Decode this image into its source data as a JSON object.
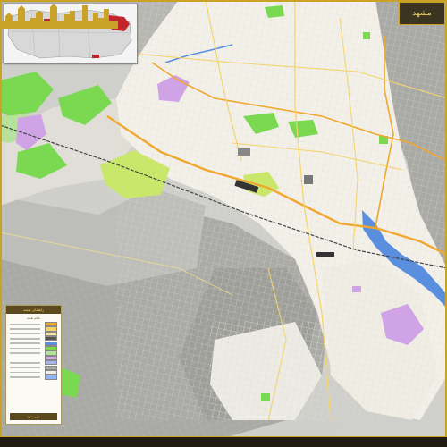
{
  "map": {
    "background": "#e6e4dc",
    "colors": {
      "urban_fabric": "#f2f0e8",
      "hills_dark": "#a9a9a5",
      "hills_light": "#cfcfcb",
      "green_space": "#7bd951",
      "park_light": "#c9e86b",
      "institutional": "#cfa3e6",
      "river": "#5a8fe0",
      "highway": "#f0a830",
      "main_road": "#f5d36b",
      "railway": "#555555",
      "frame_gold": "#c9a227",
      "brand_dark": "#5c4a1e"
    },
    "layers": [
      "built-up-area",
      "mountain-terrain",
      "green-spaces",
      "institutional-areas",
      "river",
      "highways",
      "main-roads",
      "railway"
    ]
  },
  "inset": {
    "province_highlight": "#c0262c"
  },
  "logo": {
    "text": "مشهد"
  },
  "legend": {
    "title": "راهنمای نقشه",
    "subtitle": "علائم نقشه",
    "items": [
      {
        "kind": "road-highway",
        "color": "#f0a830"
      },
      {
        "kind": "road-main",
        "color": "#f5d36b"
      },
      {
        "kind": "road-secondary",
        "color": "#f7e7a6"
      },
      {
        "kind": "railway",
        "color": "#555555"
      },
      {
        "kind": "river",
        "color": "#5a8fe0"
      },
      {
        "kind": "park",
        "color": "#7bd951"
      },
      {
        "kind": "green-belt",
        "color": "#b7e29b"
      },
      {
        "kind": "institutional",
        "color": "#cfa3e6"
      },
      {
        "kind": "education",
        "color": "#a8b7ee"
      },
      {
        "kind": "terrain",
        "color": "#a9a9a5"
      },
      {
        "kind": "urban",
        "color": "#f2f0e8"
      },
      {
        "kind": "water",
        "color": "#8fb6f0"
      }
    ],
    "footer": "شهر مشهد"
  }
}
